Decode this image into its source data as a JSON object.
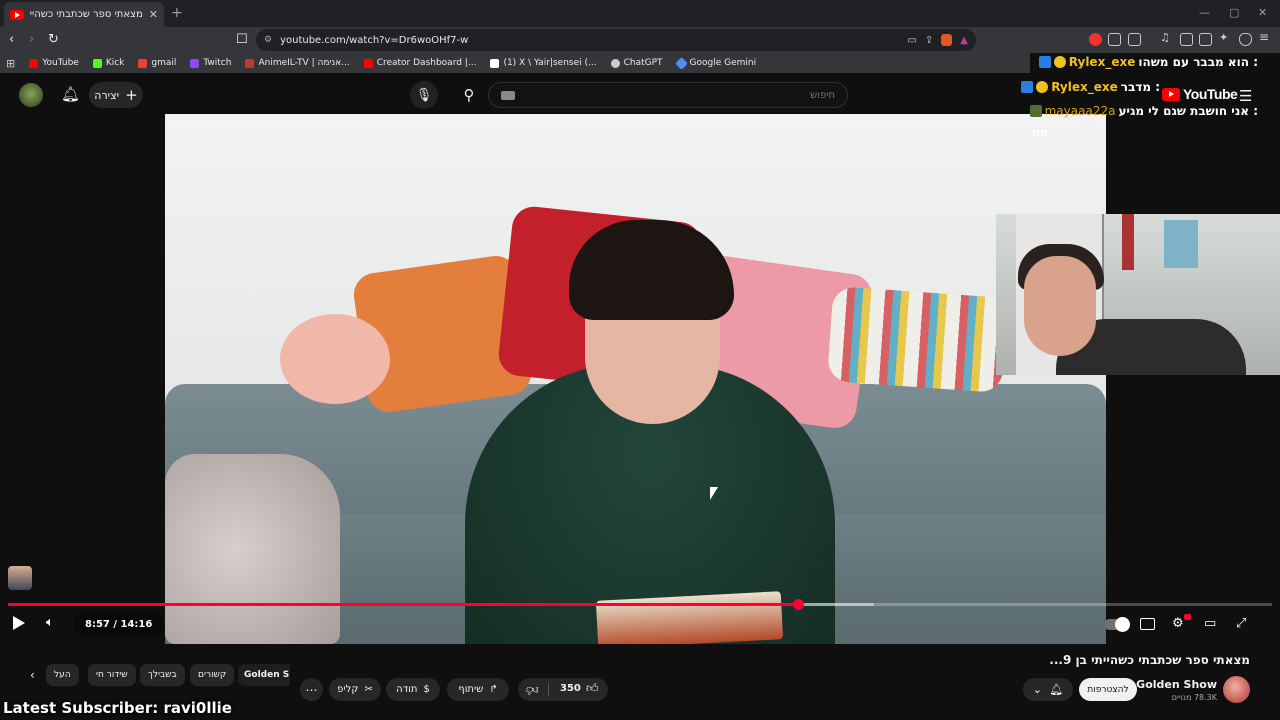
{
  "browser": {
    "tab_title": "מצאתי ספר שכתבתי כשהייתי בן 9...",
    "tab_close": "✕",
    "new_tab": "+",
    "url": "youtube.com/watch?v=Dr6woOHf7-w",
    "window_controls": [
      "—",
      "▢",
      "✕"
    ]
  },
  "bookmarks": [
    {
      "label": "YouTube",
      "color": "#ff0000"
    },
    {
      "label": "Kick",
      "color": "#53fc18"
    },
    {
      "label": "gmail",
      "color": "#ea4335"
    },
    {
      "label": "Twitch",
      "color": "#9146ff"
    },
    {
      "label": "AnimeIL-TV | אנימה...",
      "color": "#c0392b"
    },
    {
      "label": "Creator Dashboard |...",
      "color": "#ff0000"
    },
    {
      "label": "(1) X \\ Yair|sensei (...",
      "color": "#ffffff"
    },
    {
      "label": "ChatGPT",
      "color": "#cccccc"
    },
    {
      "label": "Google Gemini",
      "color": "#4f8df5"
    }
  ],
  "youtube": {
    "create_label": "יצירה",
    "search_placeholder": "חיפוש",
    "logo_text": "YouTube"
  },
  "chat": [
    {
      "user": "Rylex_exe",
      "message": "הוא מבבר עם משהו :"
    },
    {
      "user": "Rylex_exe",
      "message": "מדבר :"
    },
    {
      "user": "mayaaa22a",
      "message": "אני חושבת שגם לי מגיע :"
    },
    {
      "user": "",
      "message": "מוד"
    }
  ],
  "player": {
    "time_current": "8:57",
    "time_separator": " / ",
    "time_total": "14:16",
    "progress_played": 0.625,
    "progress_buffered": 0.685
  },
  "video": {
    "title": "מצאתי ספר שכתבתי כשהייתי בן 9...",
    "channel_name": "Golden Show",
    "subscribers": "78.3K מנויים",
    "subscribe_label": "להצטרפות",
    "like_count": "350",
    "share_label": "שיתוף",
    "thanks_label": "תודה",
    "clip_label": "קליפ"
  },
  "chips": [
    "Golden Sh",
    "קשורים",
    "בשבילך",
    "שידור חי",
    "העל"
  ],
  "overlay": {
    "latest_subscriber": "Latest Subscriber: ravi0llie"
  }
}
